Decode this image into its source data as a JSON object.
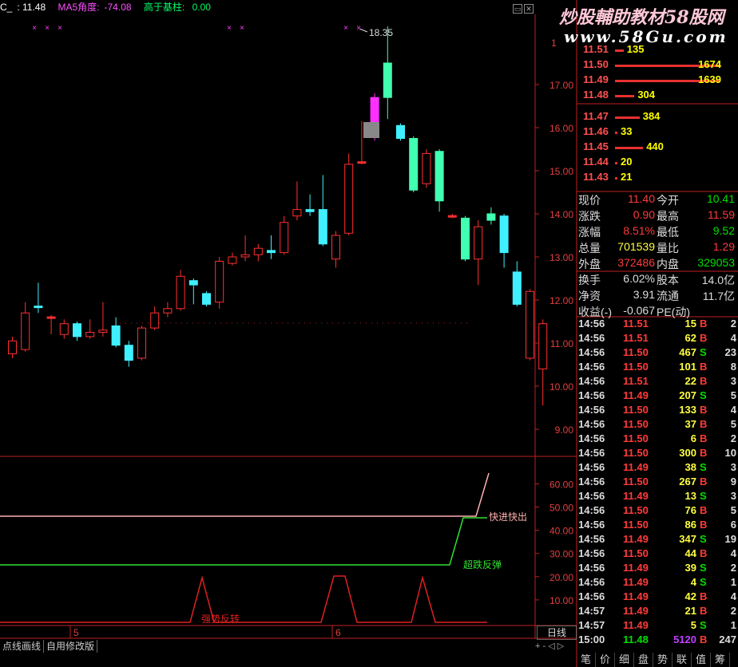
{
  "header": {
    "symbol": "C_",
    "price": "11.48",
    "ma5_label": "MA5角度:",
    "ma5_value": "-74.08",
    "base_label": "高于基柱:",
    "base_value": "0.00"
  },
  "watermark": {
    "line1": "炒股輔助教材58股网",
    "line2": "www.58Gu.com"
  },
  "chart_data": {
    "type": "candlestick",
    "y_ticks": [
      "17.00",
      "16.00",
      "15.00",
      "14.00",
      "13.00",
      "12.00",
      "11.00",
      "10.00",
      "9.00"
    ],
    "y_top_label": "1",
    "peak_label": "18.35",
    "x_labels": [
      "5",
      "6"
    ],
    "candles": [
      {
        "o": 10.75,
        "c": 11.05,
        "h": 11.15,
        "l": 10.65
      },
      {
        "o": 10.85,
        "c": 11.7,
        "h": 11.95,
        "l": 10.8
      },
      {
        "o": 11.85,
        "c": 11.82,
        "h": 12.4,
        "l": 11.7
      },
      {
        "o": 11.6,
        "c": 11.6,
        "h": 11.65,
        "l": 11.2
      },
      {
        "o": 11.2,
        "c": 11.45,
        "h": 11.55,
        "l": 11.1
      },
      {
        "o": 11.45,
        "c": 11.15,
        "h": 11.5,
        "l": 11.05
      },
      {
        "o": 11.15,
        "c": 11.25,
        "h": 11.55,
        "l": 11.1
      },
      {
        "o": 11.25,
        "c": 11.3,
        "h": 11.95,
        "l": 11.15
      },
      {
        "o": 11.4,
        "c": 10.95,
        "h": 11.6,
        "l": 10.9
      },
      {
        "o": 10.95,
        "c": 10.6,
        "h": 11.05,
        "l": 10.45
      },
      {
        "o": 10.65,
        "c": 11.35,
        "h": 11.4,
        "l": 10.6
      },
      {
        "o": 11.35,
        "c": 11.7,
        "h": 11.85,
        "l": 11.3
      },
      {
        "o": 11.7,
        "c": 11.8,
        "h": 11.95,
        "l": 11.6
      },
      {
        "o": 11.8,
        "c": 12.55,
        "h": 12.7,
        "l": 11.75
      },
      {
        "o": 12.45,
        "c": 12.35,
        "h": 12.5,
        "l": 11.9
      },
      {
        "o": 12.15,
        "c": 11.9,
        "h": 12.2,
        "l": 11.85
      },
      {
        "o": 11.95,
        "c": 12.9,
        "h": 13.0,
        "l": 11.8
      },
      {
        "o": 12.85,
        "c": 13.0,
        "h": 13.1,
        "l": 12.8
      },
      {
        "o": 13.0,
        "c": 13.05,
        "h": 13.5,
        "l": 12.9
      },
      {
        "o": 13.05,
        "c": 13.2,
        "h": 13.3,
        "l": 12.9
      },
      {
        "o": 13.15,
        "c": 13.1,
        "h": 13.5,
        "l": 12.95
      },
      {
        "o": 13.1,
        "c": 13.8,
        "h": 13.95,
        "l": 13.05
      },
      {
        "o": 13.95,
        "c": 14.1,
        "h": 14.75,
        "l": 13.85
      },
      {
        "o": 14.1,
        "c": 14.05,
        "h": 14.45,
        "l": 13.95
      },
      {
        "o": 14.1,
        "c": 13.3,
        "h": 14.9,
        "l": 13.25
      },
      {
        "o": 12.95,
        "c": 13.5,
        "h": 13.6,
        "l": 12.75
      },
      {
        "o": 13.55,
        "c": 15.15,
        "h": 15.4,
        "l": 13.5
      },
      {
        "o": 15.2,
        "c": 15.2,
        "h": 16.15,
        "l": 15.15
      },
      {
        "o": 15.85,
        "c": 16.7,
        "h": 16.8,
        "l": 15.7
      },
      {
        "o": 17.5,
        "c": 16.7,
        "h": 18.35,
        "l": 16.2
      },
      {
        "o": 16.05,
        "c": 15.75,
        "h": 16.1,
        "l": 15.7
      },
      {
        "o": 15.75,
        "c": 14.55,
        "h": 15.8,
        "l": 14.5
      },
      {
        "o": 14.7,
        "c": 15.4,
        "h": 15.5,
        "l": 14.6
      },
      {
        "o": 15.45,
        "c": 14.3,
        "h": 15.5,
        "l": 14.05
      },
      {
        "o": 13.95,
        "c": 13.95,
        "h": 14.0,
        "l": 13.9
      },
      {
        "o": 13.9,
        "c": 12.95,
        "h": 13.95,
        "l": 12.9
      },
      {
        "o": 12.95,
        "c": 13.7,
        "h": 13.85,
        "l": 12.35
      },
      {
        "o": 13.85,
        "c": 14.0,
        "h": 14.15,
        "l": 13.75
      },
      {
        "o": 13.95,
        "c": 13.1,
        "h": 14.0,
        "l": 12.75
      },
      {
        "o": 12.65,
        "c": 11.9,
        "h": 12.9,
        "l": 11.85
      },
      {
        "o": 12.2,
        "c": 10.65,
        "h": 12.25,
        "l": 10.6
      },
      {
        "o": 10.4,
        "c": 11.45,
        "h": 11.55,
        "l": 9.55
      }
    ],
    "indicator": {
      "y_ticks": [
        "60.00",
        "50.00",
        "40.00",
        "30.00",
        "20.00",
        "10.00"
      ],
      "labels": [
        "快进快出",
        "超跌反弹",
        "强势反转"
      ]
    }
  },
  "depth_sell": [
    {
      "price": "11.51",
      "vol": "135"
    },
    {
      "price": "11.50",
      "vol": "1674"
    },
    {
      "price": "11.49",
      "vol": "1639"
    },
    {
      "price": "11.48",
      "vol": "304"
    }
  ],
  "depth_buy": [
    {
      "price": "11.47",
      "vol": "384"
    },
    {
      "price": "11.46",
      "vol": "33"
    },
    {
      "price": "11.45",
      "vol": "440"
    },
    {
      "price": "11.44",
      "vol": "20"
    },
    {
      "price": "11.43",
      "vol": "21"
    }
  ],
  "quote": {
    "r1": [
      "现价",
      "11.40",
      "今开",
      "10.41"
    ],
    "r2": [
      "涨跌",
      "0.90",
      "最高",
      "11.59"
    ],
    "r3": [
      "涨幅",
      "8.51%",
      "最低",
      "9.52"
    ],
    "r4": [
      "总量",
      "701539",
      "量比",
      "1.29"
    ],
    "r5": [
      "外盘",
      "372486",
      "内盘",
      "329053"
    ],
    "r6": [
      "换手",
      "6.02%",
      "股本",
      "14.0亿"
    ],
    "r7": [
      "净资",
      "3.91",
      "流通",
      "11.7亿"
    ],
    "r8": [
      "收益(-)",
      "-0.067",
      "PE(动)",
      ""
    ]
  },
  "trades": [
    [
      "14:56",
      "11.51",
      "15",
      "B",
      "2"
    ],
    [
      "14:56",
      "11.51",
      "62",
      "B",
      "4"
    ],
    [
      "14:56",
      "11.50",
      "467",
      "S",
      "23"
    ],
    [
      "14:56",
      "11.50",
      "101",
      "B",
      "8"
    ],
    [
      "14:56",
      "11.51",
      "22",
      "B",
      "3"
    ],
    [
      "14:56",
      "11.49",
      "207",
      "S",
      "5"
    ],
    [
      "14:56",
      "11.50",
      "133",
      "B",
      "4"
    ],
    [
      "14:56",
      "11.50",
      "37",
      "B",
      "5"
    ],
    [
      "14:56",
      "11.50",
      "6",
      "B",
      "2"
    ],
    [
      "14:56",
      "11.50",
      "300",
      "B",
      "10"
    ],
    [
      "14:56",
      "11.49",
      "38",
      "S",
      "3"
    ],
    [
      "14:56",
      "11.50",
      "267",
      "B",
      "9"
    ],
    [
      "14:56",
      "11.49",
      "13",
      "S",
      "3"
    ],
    [
      "14:56",
      "11.50",
      "76",
      "B",
      "5"
    ],
    [
      "14:56",
      "11.50",
      "86",
      "B",
      "6"
    ],
    [
      "14:56",
      "11.49",
      "347",
      "S",
      "19"
    ],
    [
      "14:56",
      "11.50",
      "44",
      "B",
      "4"
    ],
    [
      "14:56",
      "11.49",
      "39",
      "S",
      "2"
    ],
    [
      "14:56",
      "11.49",
      "4",
      "S",
      "1"
    ],
    [
      "14:56",
      "11.49",
      "42",
      "B",
      "4"
    ],
    [
      "14:57",
      "11.49",
      "21",
      "B",
      "2"
    ],
    [
      "14:57",
      "11.49",
      "5",
      "S",
      "1"
    ],
    [
      "15:00",
      "11.48",
      "5120",
      "B",
      "247"
    ]
  ],
  "bottom_tabs": [
    "点线画线",
    "自用修改版"
  ],
  "day_button": "日线",
  "pm_controls": "+ - ◁ ▷",
  "right_tabs": [
    "笔",
    "价",
    "细",
    "盘",
    "势",
    "联",
    "值",
    "筹"
  ]
}
